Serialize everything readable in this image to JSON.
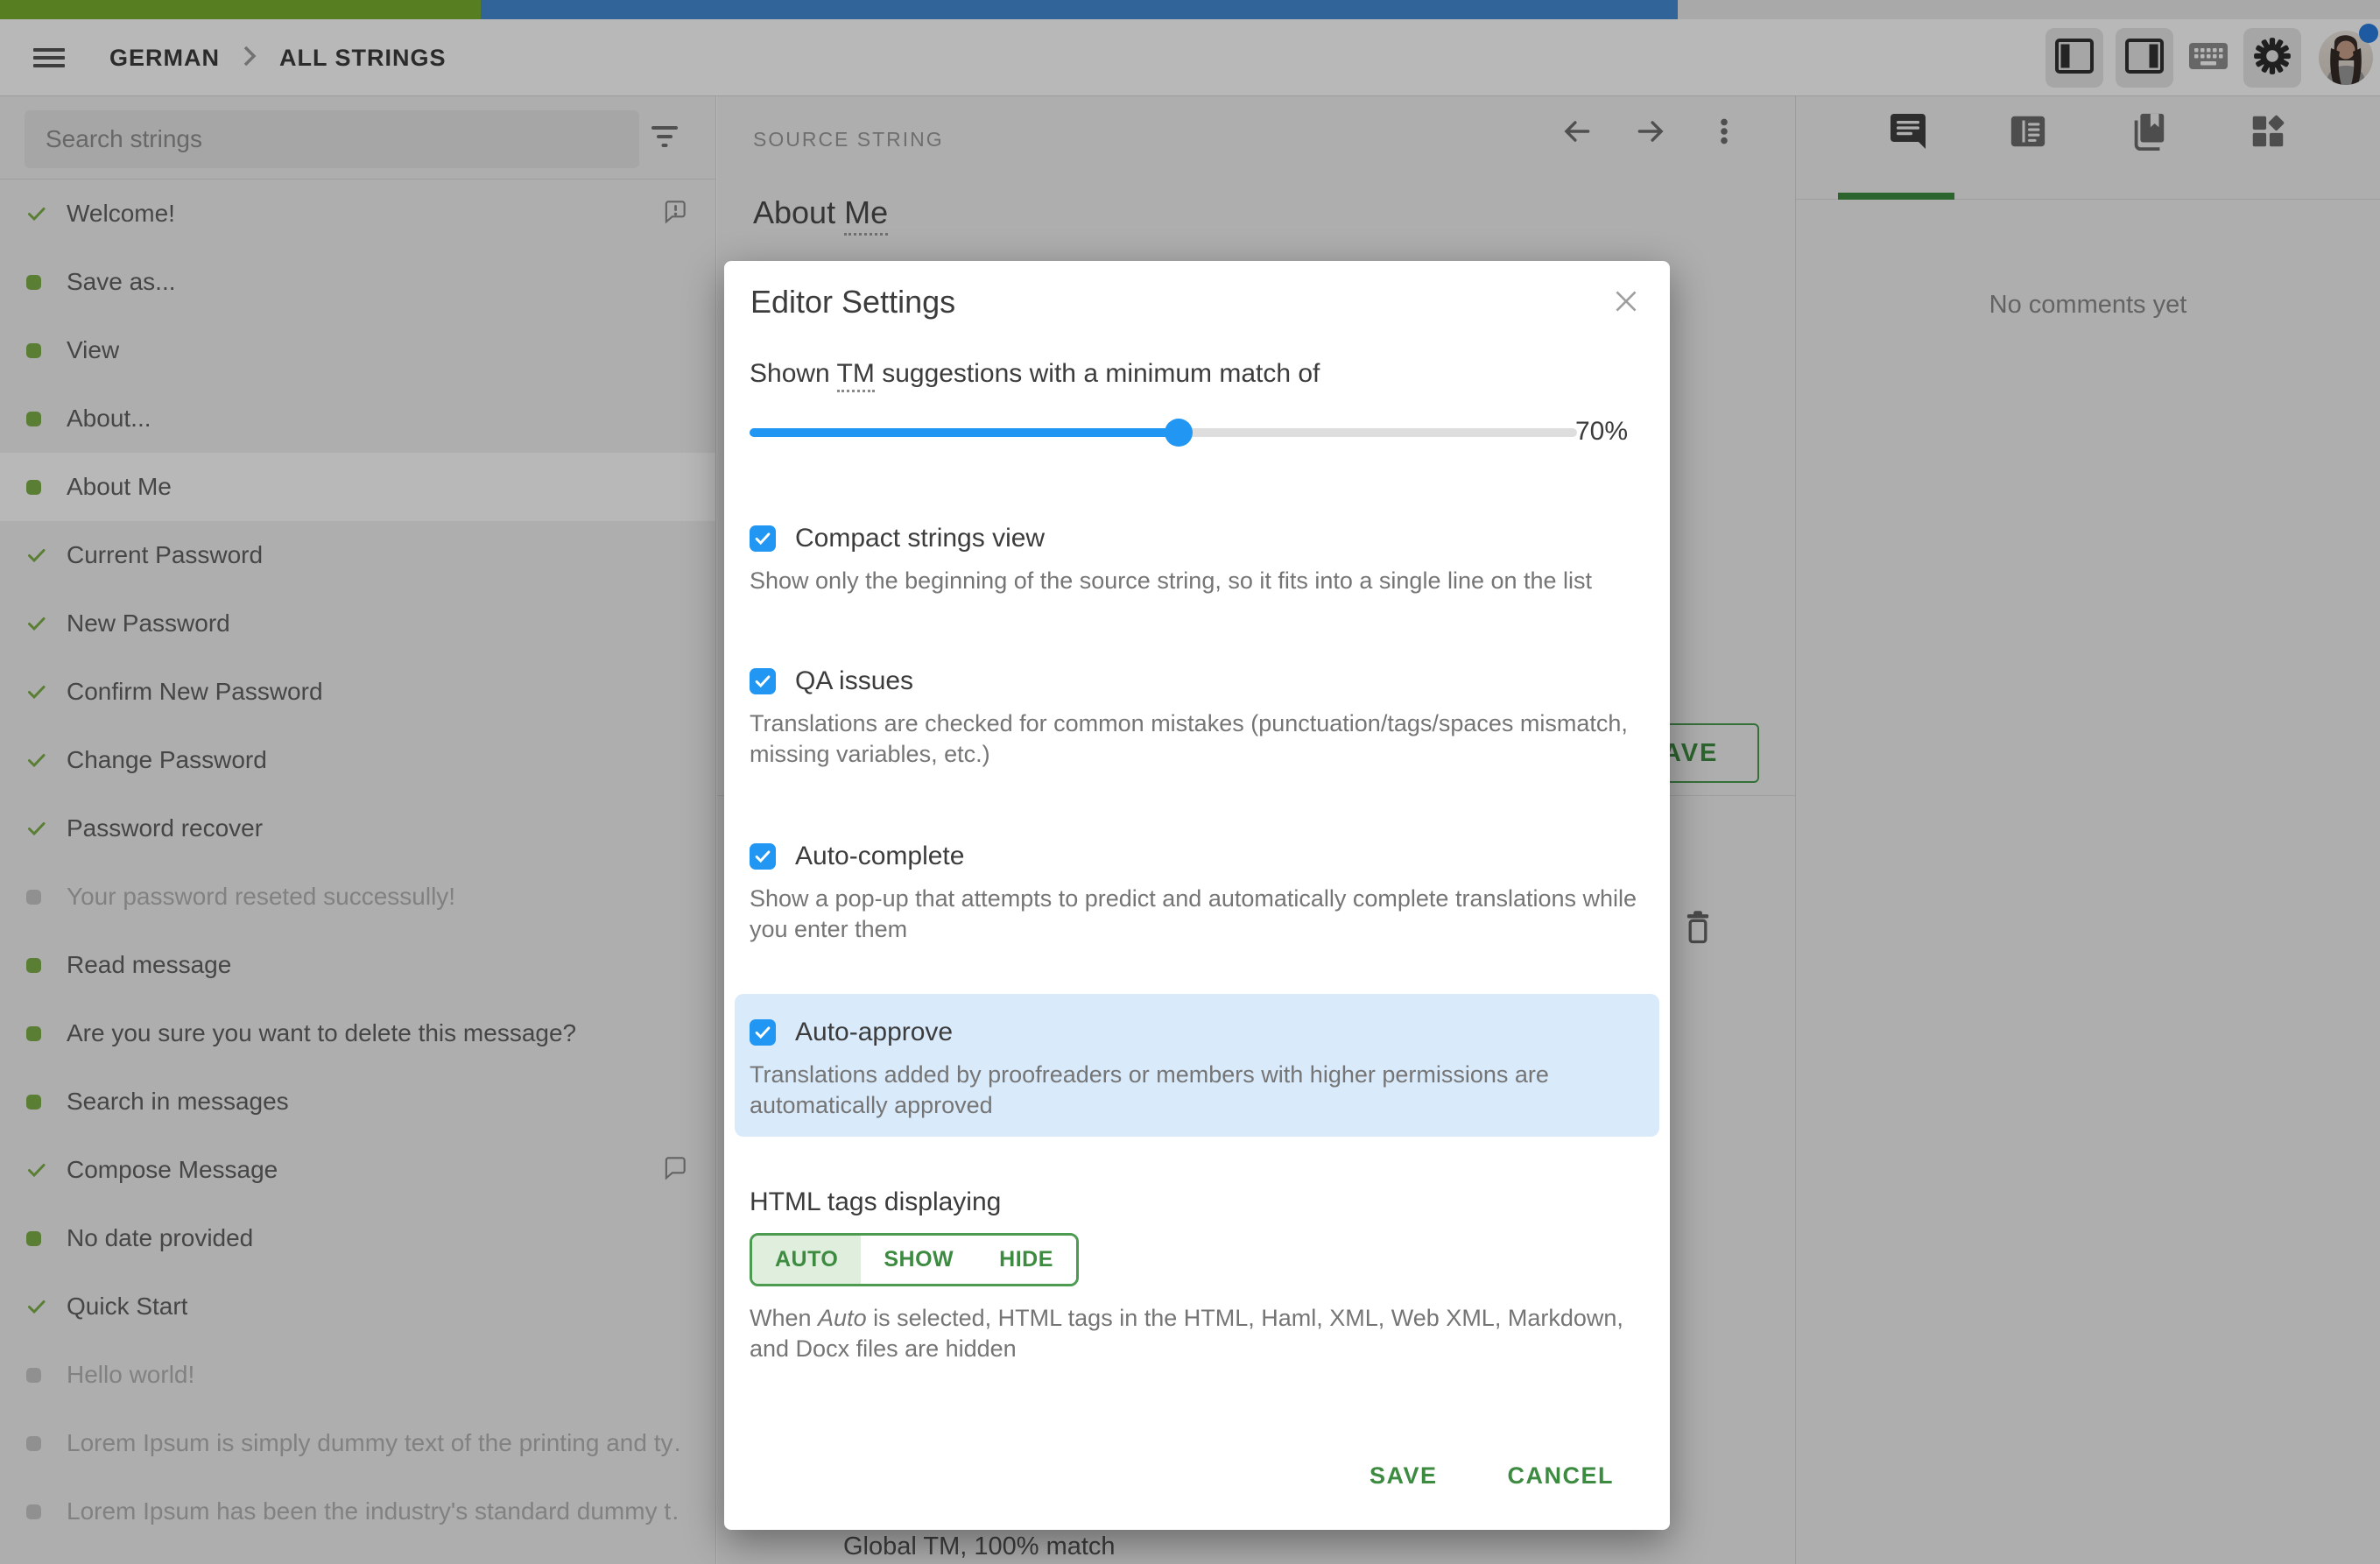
{
  "progress": {
    "approved_pct": 20.2,
    "translated_pct": 50.3
  },
  "topbar": {
    "breadcrumb": [
      "GERMAN",
      "ALL STRINGS"
    ],
    "icons": [
      "menu-icon",
      "panel-left-icon",
      "panel-right-icon",
      "keyboard-icon",
      "settings-gear-icon",
      "avatar"
    ]
  },
  "sidebar": {
    "search_placeholder": "Search strings",
    "items": [
      {
        "label": "Welcome!",
        "status": "approved",
        "comment": "alert"
      },
      {
        "label": "Save as...",
        "status": "translated"
      },
      {
        "label": "View",
        "status": "translated"
      },
      {
        "label": "About...",
        "status": "translated"
      },
      {
        "label": "About Me",
        "status": "translated",
        "active": true
      },
      {
        "label": "Current Password",
        "status": "approved"
      },
      {
        "label": "New Password",
        "status": "approved"
      },
      {
        "label": "Confirm New Password",
        "status": "approved"
      },
      {
        "label": "Change Password",
        "status": "approved"
      },
      {
        "label": "Password recover",
        "status": "approved"
      },
      {
        "label": "Your password reseted successully!",
        "status": "untranslated"
      },
      {
        "label": "Read message",
        "status": "translated"
      },
      {
        "label": "Are you sure you want to delete this message?",
        "status": "translated"
      },
      {
        "label": "Search in messages",
        "status": "translated"
      },
      {
        "label": "Compose Message",
        "status": "approved",
        "comment": "plain"
      },
      {
        "label": "No date provided",
        "status": "translated"
      },
      {
        "label": "Quick Start",
        "status": "approved"
      },
      {
        "label": "Hello world!",
        "status": "untranslated"
      },
      {
        "label": "Lorem Ipsum is simply dummy text of the printing and ty…",
        "status": "untranslated"
      },
      {
        "label": "Lorem Ipsum has been the industry's standard dummy t…",
        "status": "untranslated"
      }
    ]
  },
  "editor": {
    "header": "SOURCE STRING",
    "source_string_prefix": "About ",
    "source_string_underlined": "Me",
    "save_label": "SAVE",
    "tm_match": "Global TM, 100% match"
  },
  "comments_panel": {
    "empty_message": "No comments yet"
  },
  "modal": {
    "title": "Editor Settings",
    "tm_label_prefix": "Shown ",
    "tm_abbr": "TM",
    "tm_label_suffix": " suggestions with a minimum match of",
    "tm_value": "70%",
    "options": [
      {
        "label": "Compact strings view",
        "desc": "Show only the beginning of the source string, so it fits into a single line on the list",
        "checked": true
      },
      {
        "label": "QA issues",
        "desc": "Translations are checked for common mistakes (punctuation/tags/spaces mismatch, missing variables, etc.)",
        "checked": true
      },
      {
        "label": "Auto-complete",
        "desc": "Show a pop-up that attempts to predict and automatically complete translations while you enter them",
        "checked": true
      },
      {
        "label": "Auto-approve",
        "desc": "Translations added by proofreaders or members with higher permissions are automatically approved",
        "checked": true,
        "highlighted": true
      }
    ],
    "html_tags": {
      "heading": "HTML tags displaying",
      "buttons": [
        "AUTO",
        "SHOW",
        "HIDE"
      ],
      "selected": "AUTO",
      "desc_prefix": "When ",
      "desc_italic": "Auto",
      "desc_suffix": " is selected, HTML tags in the HTML, Haml, XML, Web XML, Markdown, and Docx files are hidden"
    },
    "save_label": "SAVE",
    "cancel_label": "CANCEL"
  },
  "colors": {
    "accent_green": "#3D8B41",
    "accent_blue": "#2196F3",
    "progress_green": "#79B030",
    "progress_blue": "#448DD6",
    "highlight_blue": "#D9EAFB",
    "status_green": "#7FAF4A"
  }
}
